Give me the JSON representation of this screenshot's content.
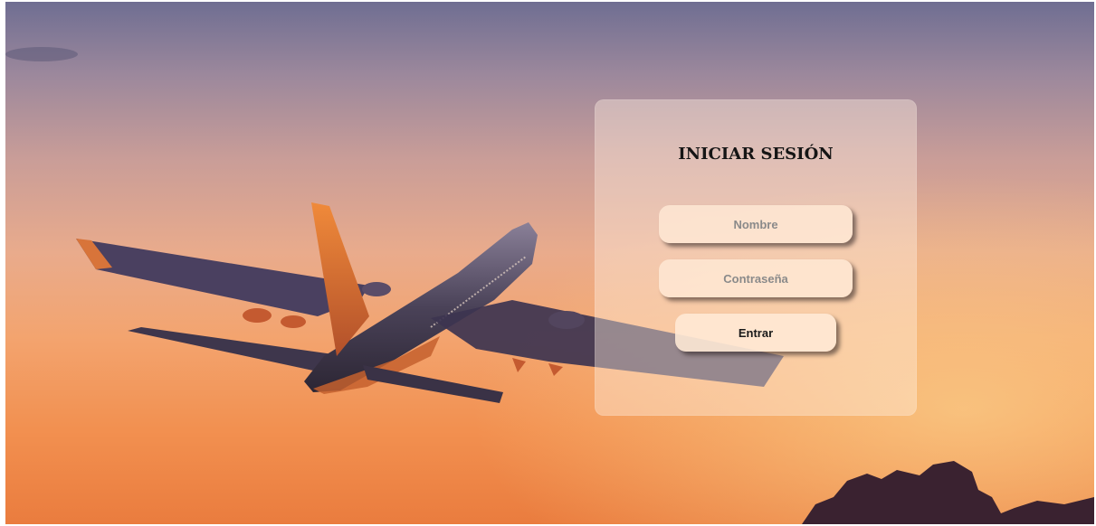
{
  "login": {
    "title": "INICIAR SESIÓN",
    "name_placeholder": "Nombre",
    "name_value": "",
    "password_placeholder": "Contraseña",
    "password_value": "",
    "submit_label": "Entrar"
  },
  "background": {
    "sky_top": "#6f6e92",
    "sky_bottom": "#ea7c3e",
    "card_tint": "#ffeee0"
  }
}
